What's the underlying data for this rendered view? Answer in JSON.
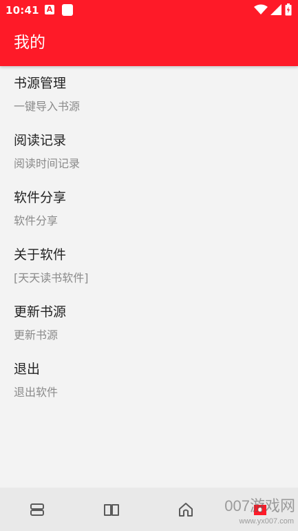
{
  "status_bar": {
    "time": "10:41",
    "a_icon_letter": "A",
    "icons": [
      "a-notification-icon",
      "sd-card-icon",
      "wifi-icon",
      "cell-signal-icon",
      "battery-icon"
    ]
  },
  "header": {
    "title": "我的",
    "color": "#fe1a28"
  },
  "menu": {
    "items": [
      {
        "title": "书源管理",
        "subtitle": "一键导入书源"
      },
      {
        "title": "阅读记录",
        "subtitle": "阅读时间记录"
      },
      {
        "title": "软件分享",
        "subtitle": "软件分享"
      },
      {
        "title": "关于软件",
        "subtitle": "[天天读书软件]"
      },
      {
        "title": "更新书源",
        "subtitle": "更新书源"
      },
      {
        "title": "退出",
        "subtitle": "退出软件"
      }
    ]
  },
  "bottom_nav": {
    "icons": [
      "shelf-icon",
      "book-icon",
      "home-icon",
      "profile-icon"
    ]
  },
  "watermark": {
    "text": "007游戏网",
    "url": "www.yx007.com"
  }
}
